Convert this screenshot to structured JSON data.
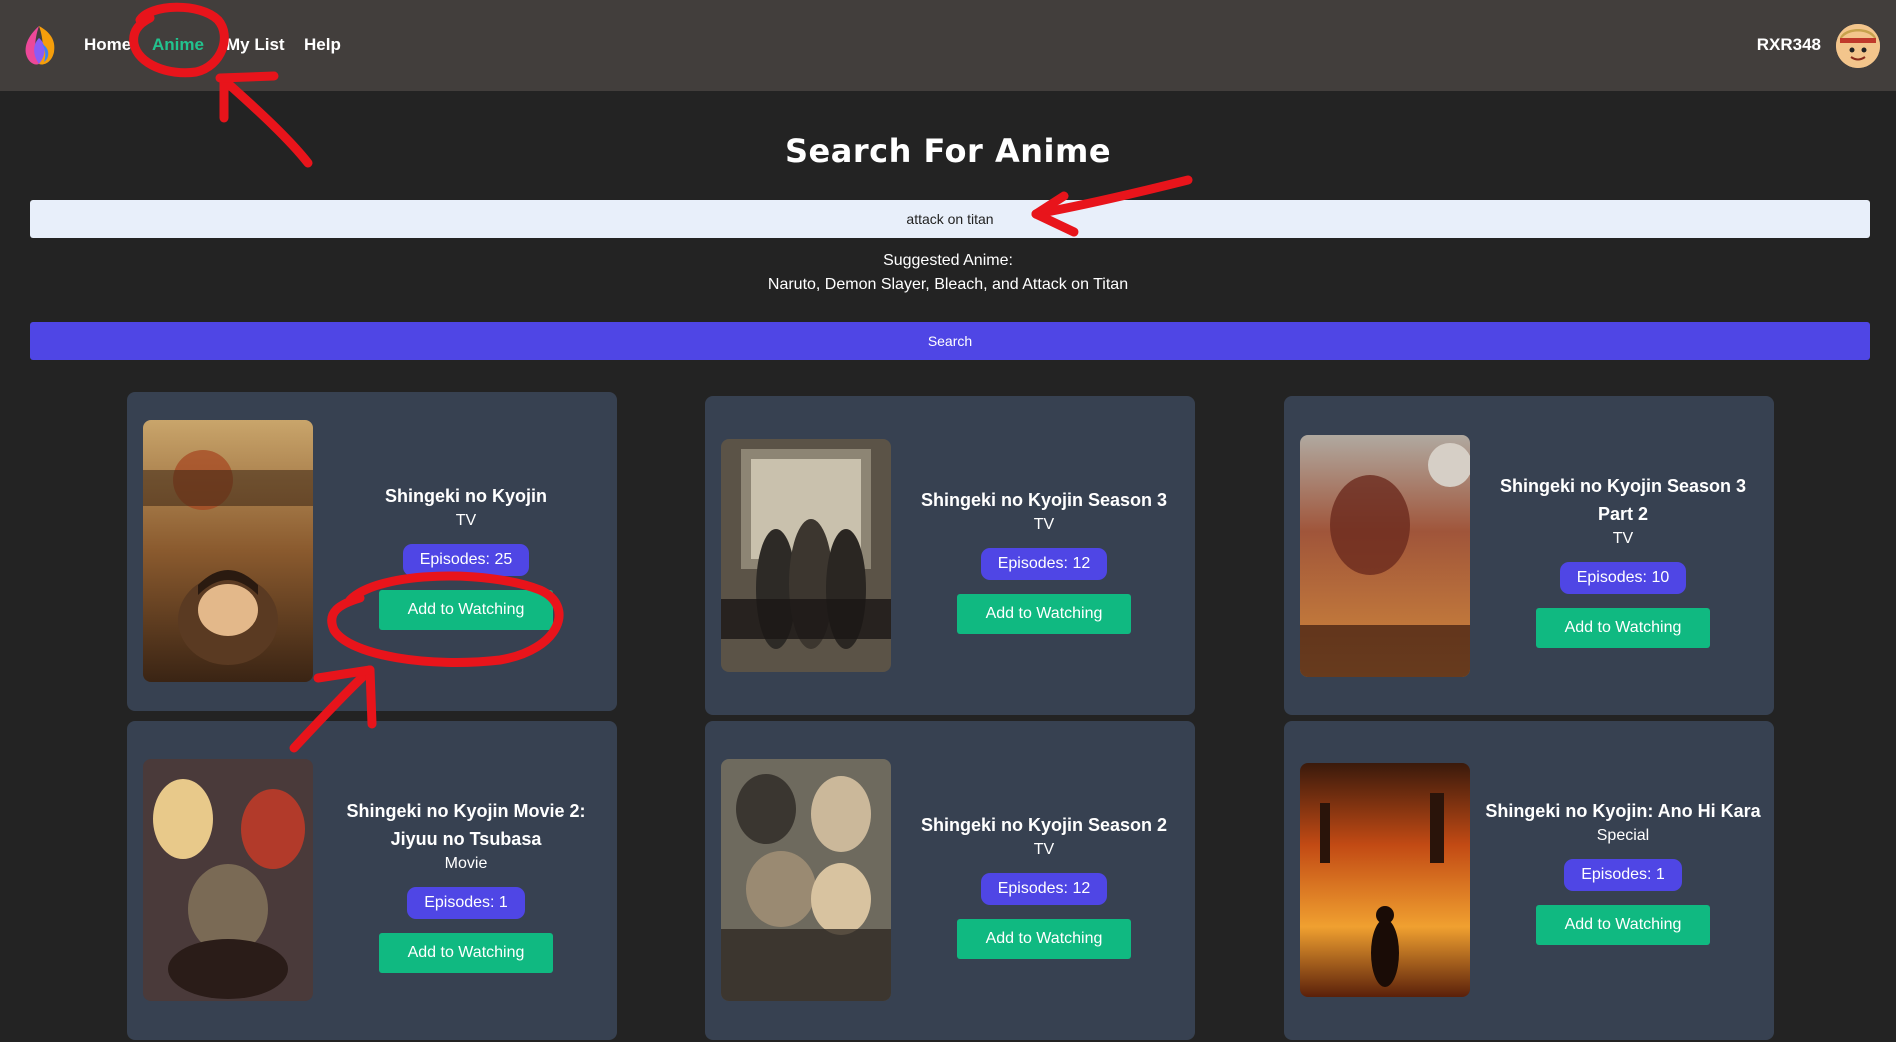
{
  "nav": {
    "links": [
      "Home",
      "Anime",
      "My List",
      "Help"
    ],
    "active": "Anime",
    "username": "RXR348"
  },
  "search": {
    "title": "Search For Anime",
    "query": "attack on titan",
    "suggested_label": "Suggested Anime:",
    "suggested_list": "Naruto, Demon Slayer, Bleach, and Attack on Titan",
    "button_label": "Search"
  },
  "results": [
    {
      "title": "Shingeki no Kyojin",
      "type": "TV",
      "episodes": "Episodes: 25",
      "button": "Add to Watching"
    },
    {
      "title": "Shingeki no Kyojin Season 3",
      "type": "TV",
      "episodes": "Episodes: 12",
      "button": "Add to Watching"
    },
    {
      "title": "Shingeki no Kyojin Season 3 Part 2",
      "type": "TV",
      "episodes": "Episodes: 10",
      "button": "Add to Watching"
    },
    {
      "title": "Shingeki no Kyojin Movie 2: Jiyuu no Tsubasa",
      "type": "Movie",
      "episodes": "Episodes: 1",
      "button": "Add to Watching"
    },
    {
      "title": "Shingeki no Kyojin Season 2",
      "type": "TV",
      "episodes": "Episodes: 12",
      "button": "Add to Watching"
    },
    {
      "title": "Shingeki no Kyojin: Ano Hi Kara",
      "type": "Special",
      "episodes": "Episodes: 1",
      "button": "Add to Watching"
    }
  ],
  "colors": {
    "navbar": "#423e3c",
    "background": "#232323",
    "card": "#374151",
    "accent_indigo": "#4f46e5",
    "accent_green": "#10b981",
    "active_link": "#22c38e",
    "annotation_red": "#e8141b"
  }
}
